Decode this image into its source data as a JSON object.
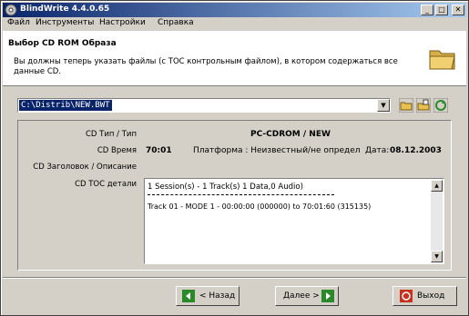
{
  "window": {
    "title": "BlindWrite 4.4.0.65"
  },
  "menu": [
    "Файл",
    "Инструменты",
    "Настройки",
    "Справка"
  ],
  "header": {
    "title": "Выбор CD ROM Образа",
    "description": "Вы должны теперь указать файлы (с TOC контрольным файлом), в котором содержаться все данные CD."
  },
  "path": {
    "value": "C:\\Distrib\\NEW.BWT"
  },
  "info": {
    "type_label": "CD Тип / Тип",
    "type_value": "PC-CDROM / NEW",
    "time_label": "CD Время",
    "time_value": "70:01",
    "platform": "Платформа : Неизвестный/не определ",
    "date_label": "Дата:",
    "date_value": "08.12.2003",
    "title_label": "CD Заголовок / Описание",
    "toc_label": "CD TOC детали",
    "toc_line1": "1 Session(s) - 1 Track(s) 1 Data,0 Audio)",
    "toc_line2": "Track 01 - MODE 1 - 00:00:00 (000000) to 70:01:60 (315135)"
  },
  "buttons": {
    "back": "< Назад",
    "next": "Далее >",
    "exit": "Выход"
  },
  "colors": {
    "selection": "#0a246a",
    "window": "#d4d0c8"
  }
}
